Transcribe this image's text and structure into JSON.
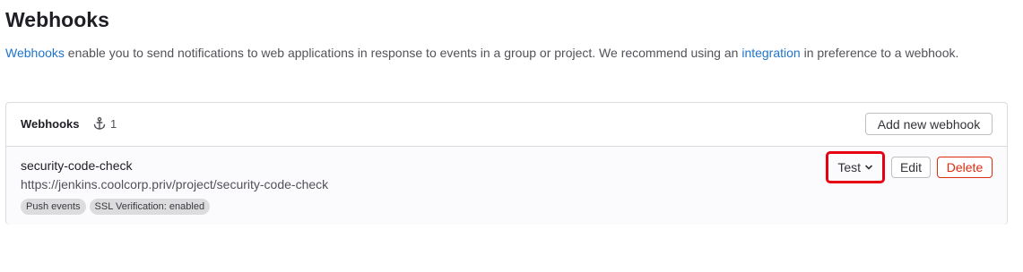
{
  "page": {
    "title": "Webhooks",
    "description": {
      "link1": "Webhooks",
      "text1": " enable you to send notifications to web applications in response to events in a group or project. We recommend using an ",
      "link2": "integration",
      "text2": " in preference to a webhook."
    }
  },
  "card": {
    "title": "Webhooks",
    "count_icon": "anchor-icon",
    "count": "1",
    "add_button": "Add new webhook"
  },
  "hooks": [
    {
      "name": "security-code-check",
      "url": "https://jenkins.coolcorp.priv/project/security-code-check",
      "badges": [
        "Push events",
        "SSL Verification: enabled"
      ],
      "test_label": "Test",
      "test_icon": "chevron-down-icon",
      "edit_label": "Edit",
      "delete_label": "Delete"
    }
  ],
  "colors": {
    "link": "#1f75cb",
    "danger": "#dd2b0e",
    "highlight": "#e60012"
  }
}
